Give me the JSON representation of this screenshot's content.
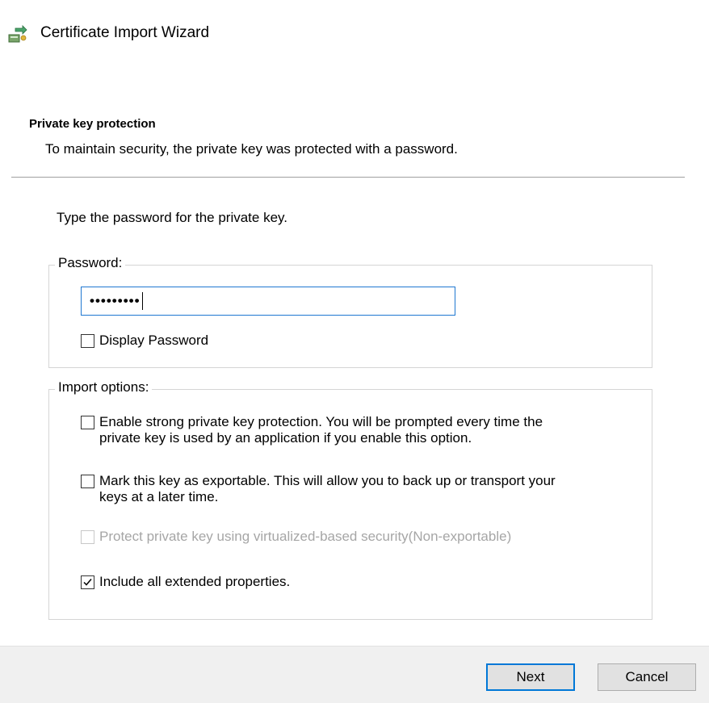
{
  "window": {
    "title": "Certificate Import Wizard",
    "icon": "certificate-wizard-icon"
  },
  "header": {
    "title": "Private key protection",
    "description": "To maintain security, the private key was protected with a password."
  },
  "main": {
    "prompt": "Type the password for the private key.",
    "password_group": {
      "legend": "Password:",
      "value": "•••••••••",
      "display_password_label": "Display Password",
      "display_password_checked": false
    },
    "import_group": {
      "legend": "Import options:",
      "options": [
        {
          "line1": "Enable strong private key protection. You will be prompted every time the",
          "line2": "private key is used by an application if you enable this option.",
          "checked": false,
          "enabled": true
        },
        {
          "line1": "Mark this key as exportable. This will allow you to back up or transport your",
          "line2": "keys at a later time.",
          "checked": false,
          "enabled": true
        },
        {
          "line1": "Protect private key using virtualized-based security(Non-exportable)",
          "checked": false,
          "enabled": false
        },
        {
          "line1": "Include all extended properties.",
          "checked": true,
          "enabled": true
        }
      ]
    }
  },
  "footer": {
    "next_label": "Next",
    "cancel_label": "Cancel"
  },
  "colors": {
    "accent": "#0078d7",
    "input_border": "#1f78d1",
    "footer_bg": "#f0f0f0"
  }
}
